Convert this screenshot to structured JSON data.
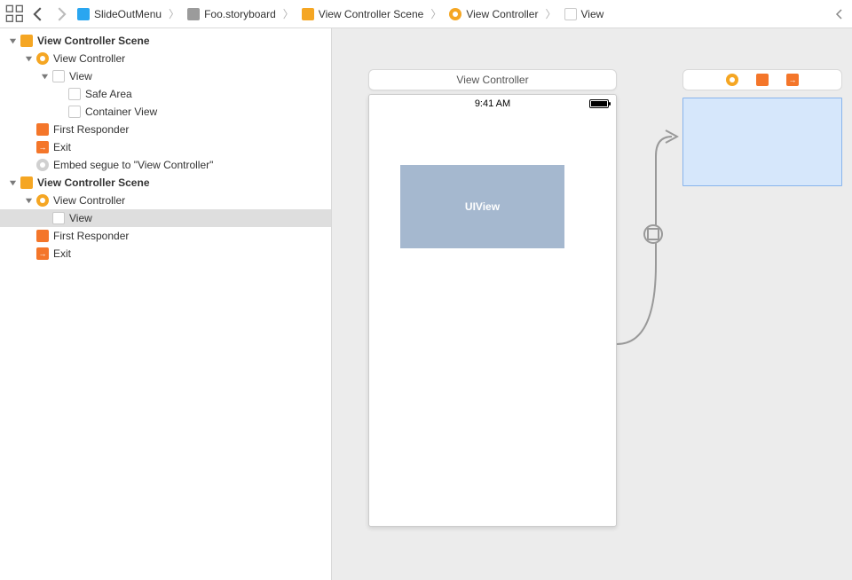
{
  "breadcrumb": {
    "items": [
      {
        "icon": "doc-blue",
        "label": "SlideOutMenu"
      },
      {
        "icon": "doc-grey",
        "label": "Foo.storyboard"
      },
      {
        "icon": "scene-yellow",
        "label": "View Controller Scene"
      },
      {
        "icon": "vc-yellow",
        "label": "View Controller"
      },
      {
        "icon": "view",
        "label": "View"
      }
    ]
  },
  "outline": {
    "scene1": {
      "title": "View Controller Scene",
      "vc": "View Controller",
      "view": "View",
      "safe_area": "Safe Area",
      "container": "Container View",
      "first_responder": "First Responder",
      "exit": "Exit",
      "embed_segue": "Embed segue to \"View Controller\""
    },
    "scene2": {
      "title": "View Controller Scene",
      "vc": "View Controller",
      "view": "View",
      "first_responder": "First Responder",
      "exit": "Exit"
    }
  },
  "canvas": {
    "scene1_label": "View Controller",
    "status_time": "9:41 AM",
    "uiview_label": "UIView"
  }
}
